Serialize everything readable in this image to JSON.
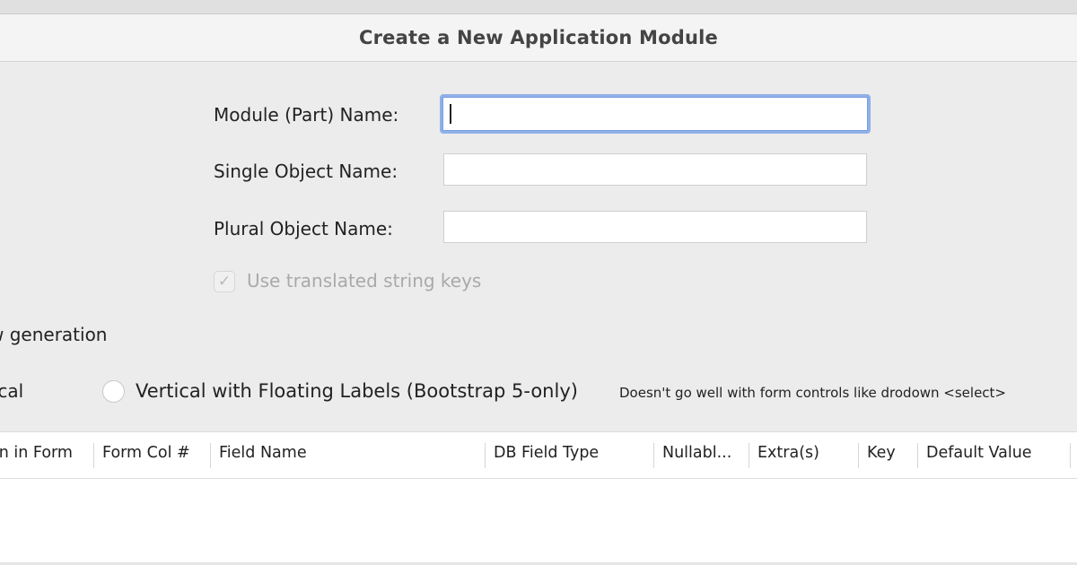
{
  "window": {
    "title": "Create a New Application Module"
  },
  "form": {
    "module_name_label": "Module (Part) Name:",
    "module_name_value": "",
    "single_object_label": "Single Object Name:",
    "single_object_value": "",
    "plural_object_label": "Plural Object Name:",
    "plural_object_value": "",
    "translated_keys_label": "Use translated string keys",
    "translated_keys_checked": true
  },
  "view_generation": {
    "section_label": "w generation",
    "option_vertical_label": "tical",
    "option_floating_label": "Vertical with Floating Labels (Bootstrap 5-only)",
    "option_floating_hint": "Doesn't go well with form controls like drodown  <select>"
  },
  "fields_table": {
    "columns": [
      "on in Form",
      "Form Col #",
      "Field Name",
      "DB Field Type",
      "Nullabl...",
      "Extra(s)",
      "Key",
      "Default Value"
    ],
    "rows": []
  },
  "icons": {
    "checkbox_check": "checkmark-icon"
  }
}
